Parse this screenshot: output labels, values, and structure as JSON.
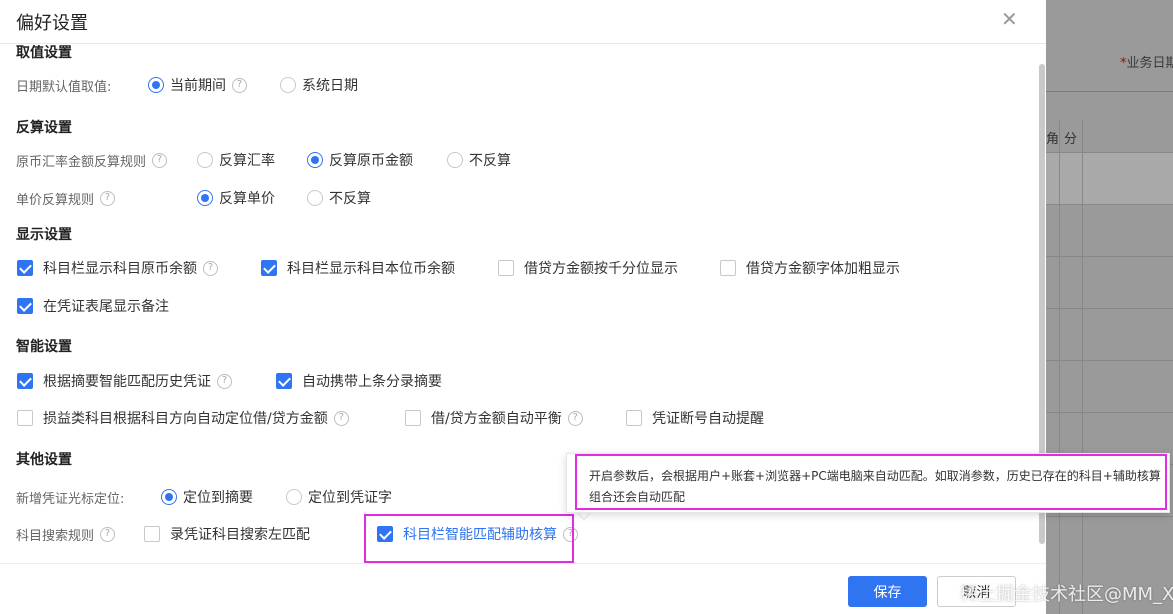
{
  "dialog": {
    "title": "偏好设置",
    "close_icon": "✕"
  },
  "background": {
    "field_required": "*",
    "field_label": "业务日期",
    "col1": "角",
    "col2": "分"
  },
  "sections": {
    "value": {
      "title": "取值设置",
      "date_label": "日期默认值取值:",
      "opt_period": "当前期间",
      "opt_system": "系统日期"
    },
    "reverse": {
      "title": "反算设置",
      "rate_label": "原币汇率金额反算规则",
      "opt_rate": "反算汇率",
      "opt_original": "反算原币金额",
      "opt_none": "不反算",
      "price_label": "单价反算规则",
      "opt_price": "反算单价",
      "opt_price_none": "不反算"
    },
    "display": {
      "title": "显示设置",
      "cb1": "科目栏显示科目原币余额",
      "cb2": "科目栏显示科目本位币余额",
      "cb3": "借贷方金额按千分位显示",
      "cb4": "借贷方金额字体加粗显示",
      "cb5": "在凭证表尾显示备注"
    },
    "smart": {
      "title": "智能设置",
      "cb1": "根据摘要智能匹配历史凭证",
      "cb2": "自动携带上条分录摘要",
      "cb3": "损益类科目根据科目方向自动定位借/贷方金额",
      "cb4": "借/贷方金额自动平衡",
      "cb5": "凭证断号自动提醒"
    },
    "other": {
      "title": "其他设置",
      "cursor_label": "新增凭证光标定位:",
      "opt_summary": "定位到摘要",
      "opt_voucher": "定位到凭证字",
      "search_label": "科目搜索规则",
      "cb_left": "录凭证科目搜索左匹配",
      "cb_smart": "科目栏智能匹配辅助核算"
    }
  },
  "tooltip": {
    "text": "开启参数后，会根据用户+账套+浏览器+PC端电脑来自动匹配。如取消参数，历史已存在的科目+辅助核算组合还会自动匹配"
  },
  "footer": {
    "save": "保存",
    "cancel": "取消"
  },
  "watermark": "稀土掘金技术社区@MM_XIAO",
  "colors": {
    "accent": "#2f74f0",
    "highlight": "#e22ce2"
  }
}
